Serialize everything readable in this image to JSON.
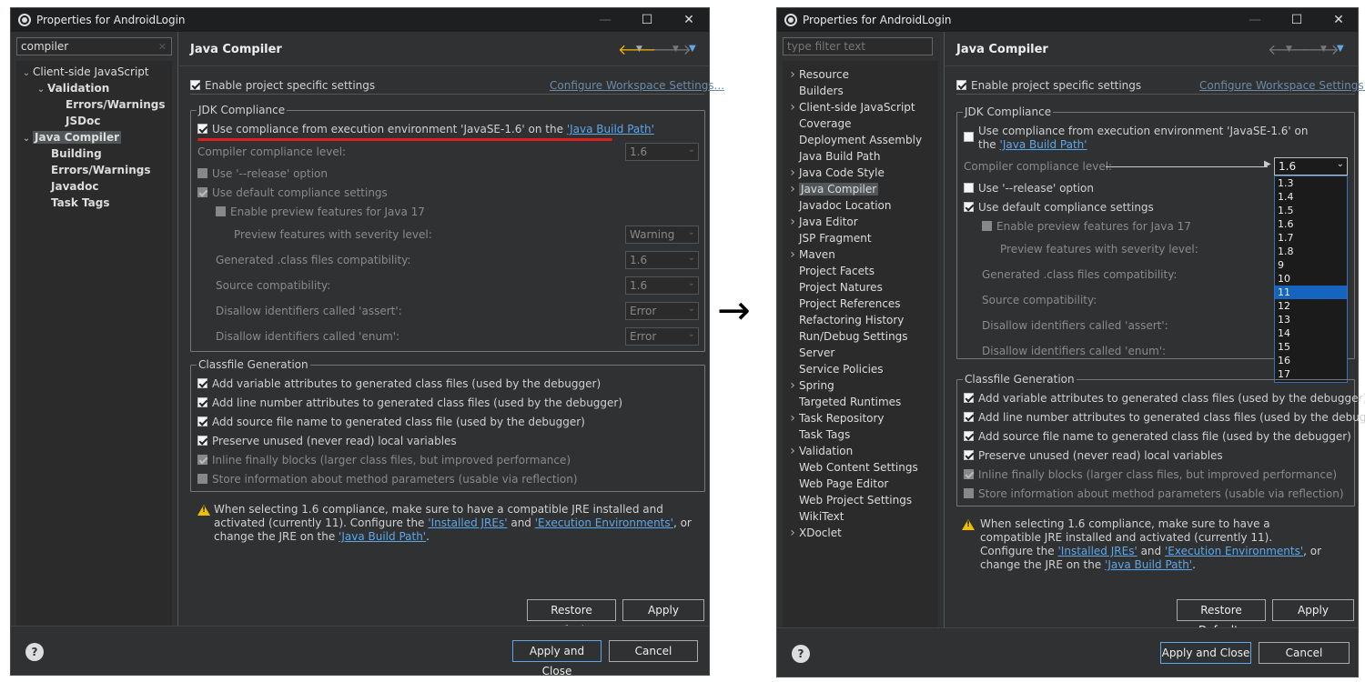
{
  "window_title": "Properties for AndroidLogin",
  "arrow": "→",
  "left_panel": {
    "filter_value": "compiler",
    "tree": [
      {
        "label": "Client-side JavaScript",
        "expanded": true
      },
      {
        "label": "Validation"
      },
      {
        "label": "Errors/Warnings"
      },
      {
        "label": "JSDoc"
      },
      {
        "label": "Java Compiler"
      },
      {
        "label": "Building"
      },
      {
        "label": "Errors/Warnings"
      },
      {
        "label": "Javadoc"
      },
      {
        "label": "Task Tags"
      }
    ]
  },
  "right_panel": {
    "filter_placeholder": "type filter text",
    "tree": [
      "Resource",
      "Builders",
      "Client-side JavaScript",
      "Coverage",
      "Deployment Assembly",
      "Java Build Path",
      "Java Code Style",
      "Java Compiler",
      "Javadoc Location",
      "Java Editor",
      "JSP Fragment",
      "Maven",
      "Project Facets",
      "Project Natures",
      "Project References",
      "Refactoring History",
      "Run/Debug Settings",
      "Server",
      "Service Policies",
      "Spring",
      "Targeted Runtimes",
      "Task Repository",
      "Task Tags",
      "Validation",
      "Web Content Settings",
      "Web Page Editor",
      "Web Project Settings",
      "WikiText",
      "XDoclet"
    ],
    "dropdown_options": [
      "1.3",
      "1.4",
      "1.5",
      "1.6",
      "1.7",
      "1.8",
      "9",
      "10",
      "11",
      "12",
      "13",
      "14",
      "15",
      "16",
      "17"
    ],
    "dropdown_highlight": "11"
  },
  "page": {
    "title": "Java Compiler",
    "enable_project_specific": "Enable project specific settings",
    "configure_workspace": "Configure Workspace Settings...",
    "jdk_group": "JDK Compliance",
    "use_compliance_prefix": "Use compliance from execution environment 'JavaSE-1.6' on the",
    "use_compliance_link": "'Java Build Path'",
    "compliance_level_label": "Compiler compliance level:",
    "compliance_level_value": "1.6",
    "release_option": "Use '--release' option",
    "default_compliance": "Use default compliance settings",
    "enable_preview": "Enable preview features for Java 17",
    "preview_severity_label": "Preview features with severity level:",
    "preview_severity_value": "Warning",
    "generated_class_label": "Generated .class files compatibility:",
    "generated_class_value": "1.6",
    "source_compat_label": "Source compatibility:",
    "source_compat_value": "1.6",
    "disallow_assert_label": "Disallow identifiers called 'assert':",
    "disallow_assert_value": "Error",
    "disallow_enum_label": "Disallow identifiers called 'enum':",
    "disallow_enum_value": "Error",
    "classfile_group": "Classfile Generation",
    "opt_variable": "Add variable attributes to generated class files (used by the debugger)",
    "opt_line": "Add line number attributes to generated class files (used by the debugger)",
    "opt_source": "Add source file name to generated class file (used by the debugger)",
    "opt_preserve": "Preserve unused (never read) local variables",
    "opt_inline": "Inline finally blocks (larger class files, but improved performance)",
    "opt_store": "Store information about method parameters (usable via reflection)",
    "warning_text_1": "When selecting 1.6 compliance, make sure to have a compatible JRE installed and activated (currently 11). Configure the",
    "link_installed_jres": "'Installed JREs'",
    "and": "and",
    "link_exec_envs": "'Execution Environments'",
    "warning_text_2": ", or change the JRE on the",
    "link_build_path": "'Java Build Path'",
    "period": "."
  },
  "buttons": {
    "restore_defaults": "Restore Defaults",
    "apply": "Apply",
    "apply_and_close": "Apply and Close",
    "cancel": "Cancel",
    "help": "?"
  },
  "colors": {
    "annotation_red": "#e02020",
    "link": "#5ea7e8",
    "highlight": "#1565c0"
  }
}
